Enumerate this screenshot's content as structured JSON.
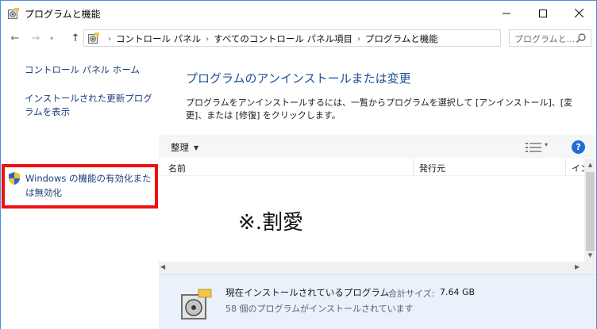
{
  "window": {
    "title": "プログラムと機能",
    "minimize_glyph": "—",
    "maximize_glyph": "☐",
    "close_glyph": "✕"
  },
  "nav": {
    "back_glyph": "←",
    "forward_glyph": "→",
    "recent_glyph": "▾",
    "up_glyph": "↑",
    "breadcrumbs": [
      "コントロール パネル",
      "すべてのコントロール パネル項目",
      "プログラムと機能"
    ],
    "crumb_separator": "›",
    "dropdown_glyph": "⌄",
    "refresh_glyph": "↻",
    "search_placeholder": "プログラムと..."
  },
  "sidebar": {
    "home_link": "コントロール パネル ホーム",
    "updates_link": "インストールされた更新プログラムを表示",
    "features_link": "Windows の機能の有効化または無効化"
  },
  "main": {
    "title": "プログラムのアンインストールまたは変更",
    "description": "プログラムをアンインストールするには、一覧からプログラムを選択して [アンインストール]、[変更]、または [修復] をクリックします。",
    "organize_label": "整理",
    "organize_arrow": "▼",
    "view_arrow": "▾",
    "help_label": "?"
  },
  "columns": {
    "name": "名前",
    "publisher": "発行元",
    "install_truncated": "イン"
  },
  "list": {
    "redacted_note": "※.割愛"
  },
  "scrollbars": {
    "up": "▲",
    "down": "▼",
    "left": "◀",
    "right": "▶"
  },
  "details": {
    "title": "現在インストールされているプログラム",
    "size_label": "合計サイズ:",
    "size_value": "7.64 GB",
    "count_text": "58 個のプログラムがインストールされています"
  },
  "colors": {
    "frame": "#4a8fd8",
    "highlight_box": "#ee1111",
    "link": "#1a3f7a",
    "heading": "#1e4f99",
    "help": "#1f6fd1",
    "details_bg": "#eaf1fa"
  }
}
